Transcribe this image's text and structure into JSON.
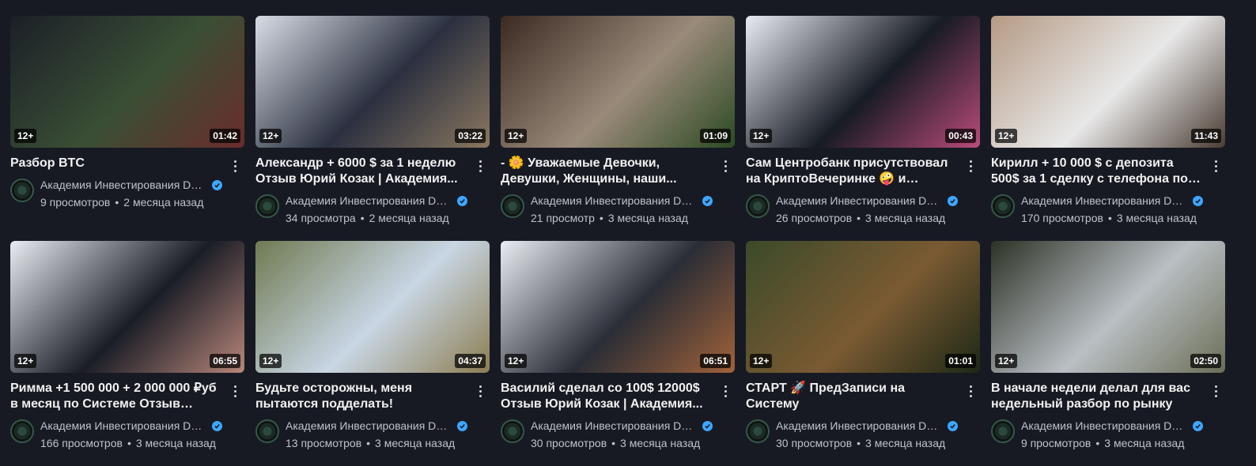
{
  "channel": "Академия Инвестирования DeM WI...",
  "videos": [
    {
      "title": "Разбор BTC",
      "age": "12+",
      "duration": "01:42",
      "views": "9 просмотров",
      "date": "2 месяца назад",
      "palette": [
        "#1b1f27",
        "#3a4f35",
        "#6b2c2c"
      ]
    },
    {
      "title": "Александр + 6000 $ за 1 неделю Отзыв Юрий Козак | Академия...",
      "age": "12+",
      "duration": "03:22",
      "views": "34 просмотра",
      "date": "2 месяца назад",
      "palette": [
        "#d8dde5",
        "#2b3040",
        "#8a7760"
      ]
    },
    {
      "title": "- 🌼 Уважаемые Девочки, Девушки, Женщины, наши...",
      "age": "12+",
      "duration": "01:09",
      "views": "21 просмотр",
      "date": "3 месяца назад",
      "palette": [
        "#3a2a22",
        "#9a8a7a",
        "#2c4a22"
      ]
    },
    {
      "title": "Сам Центробанк присутствовал на КриптоВечеринке 🤪 и сверял...",
      "age": "12+",
      "duration": "00:43",
      "views": "26 просмотров",
      "date": "3 месяца назад",
      "palette": [
        "#e9ecf2",
        "#171b24",
        "#b94b7a"
      ]
    },
    {
      "title": "Кирилл + 10 000 $ с депозита 500$ за 1 сделку с телефона по Систе...",
      "age": "12+",
      "duration": "11:43",
      "views": "170 просмотров",
      "date": "3 месяца назад",
      "palette": [
        "#b59a84",
        "#e8e8e8",
        "#4a3c33"
      ]
    },
    {
      "title": "Римма +1 500 000 + 2 000 000 ₽уб в месяц по Системе Отзыв Юрий...",
      "age": "12+",
      "duration": "06:55",
      "views": "166 просмотров",
      "date": "3 месяца назад",
      "palette": [
        "#e9ecf2",
        "#1a1d26",
        "#b7867a"
      ]
    },
    {
      "title": "Будьте осторожны, меня пытаются подделать!",
      "age": "12+",
      "duration": "04:37",
      "views": "13 просмотров",
      "date": "3 месяца назад",
      "palette": [
        "#6f7a52",
        "#c9d6e4",
        "#8b7d52"
      ]
    },
    {
      "title": "Василий сделал со 100$ 12000$ Отзыв Юрий Козак | Академия...",
      "age": "12+",
      "duration": "06:51",
      "views": "30 просмотров",
      "date": "3 месяца назад",
      "palette": [
        "#e9ecf2",
        "#2a2d36",
        "#a0623a"
      ]
    },
    {
      "title": "СТАРТ 🚀 ПредЗаписи на Систему",
      "age": "12+",
      "duration": "01:01",
      "views": "30 просмотров",
      "date": "3 месяца назад",
      "palette": [
        "#3b4a2a",
        "#7a5a32",
        "#1d2816"
      ]
    },
    {
      "title": "В начале недели делал для вас недельный разбор по рынку",
      "age": "12+",
      "duration": "02:50",
      "views": "9 просмотров",
      "date": "3 месяца назад",
      "palette": [
        "#2d3226",
        "#b9bfc4",
        "#6b6e56"
      ]
    }
  ]
}
